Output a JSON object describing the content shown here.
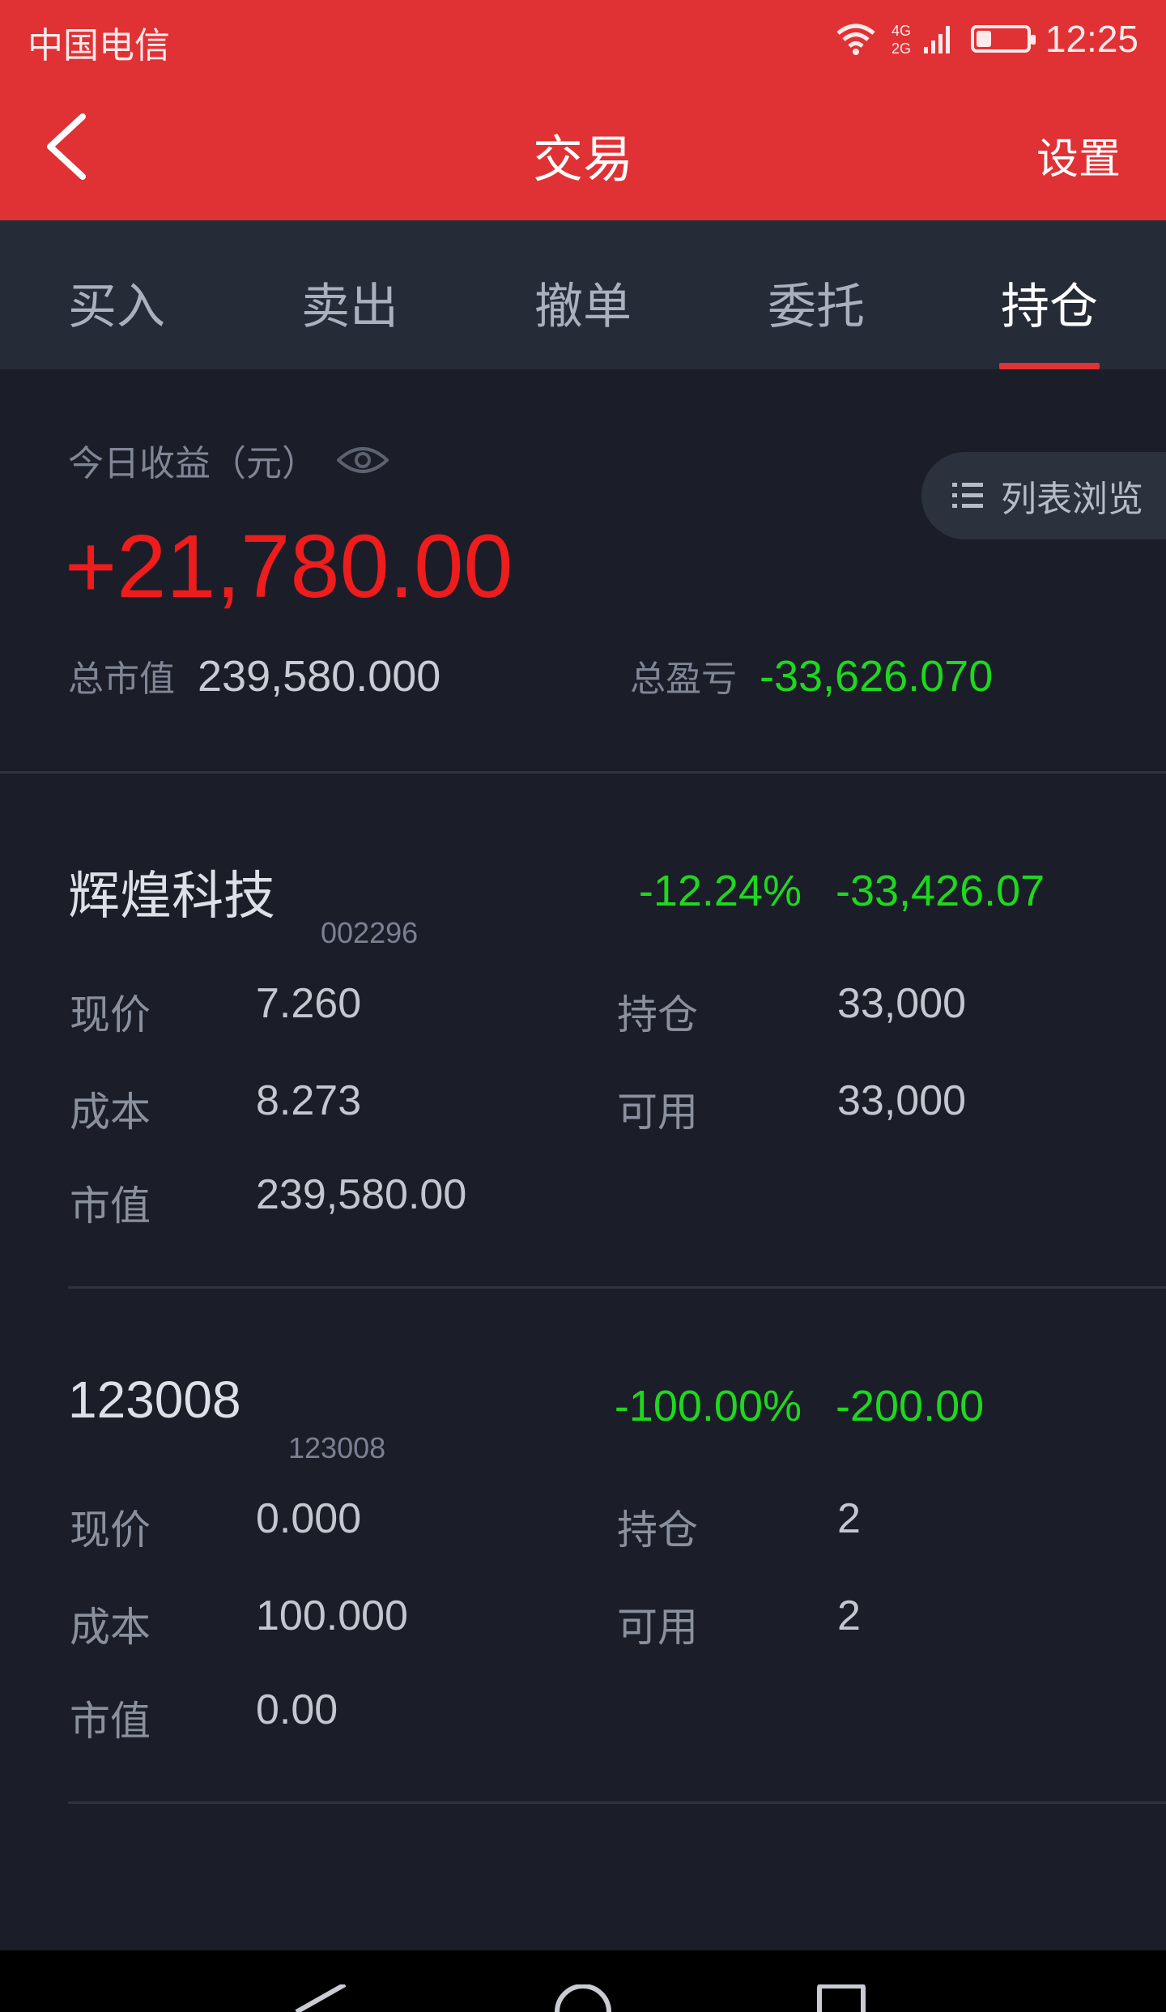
{
  "status_bar": {
    "carrier": "中国电信",
    "network": "4G 2G",
    "time": "12:25",
    "battery_level": 0.3
  },
  "header": {
    "title": "交易",
    "settings_label": "设置"
  },
  "tabs": [
    {
      "label": "买入"
    },
    {
      "label": "卖出"
    },
    {
      "label": "撤单"
    },
    {
      "label": "委托"
    },
    {
      "label": "持仓",
      "active": true
    }
  ],
  "summary": {
    "today_label": "今日收益（元）",
    "today_value": "+21,780.00",
    "list_view_label": "列表浏览",
    "market_value_label": "总市值",
    "market_value": "239,580.000",
    "total_pl_label": "总盈亏",
    "total_pl": "-33,626.070"
  },
  "field_labels": {
    "price": "现价",
    "cost": "成本",
    "market_value": "市值",
    "position": "持仓",
    "available": "可用"
  },
  "holdings": [
    {
      "name": "辉煌科技",
      "code": "002296",
      "pct": "-12.24%",
      "pl": "-33,426.07",
      "price": "7.260",
      "cost": "8.273",
      "market_value": "239,580.00",
      "position": "33,000",
      "available": "33,000"
    },
    {
      "name": "123008",
      "code": "123008",
      "pct": "-100.00%",
      "pl": "-200.00",
      "price": "0.000",
      "cost": "100.000",
      "market_value": "0.00",
      "position": "2",
      "available": "2"
    }
  ],
  "colors": {
    "header_red": "#e03135",
    "profit_red": "#ee1c1c",
    "loss_green": "#1ed81e",
    "background": "#1b1e28"
  }
}
